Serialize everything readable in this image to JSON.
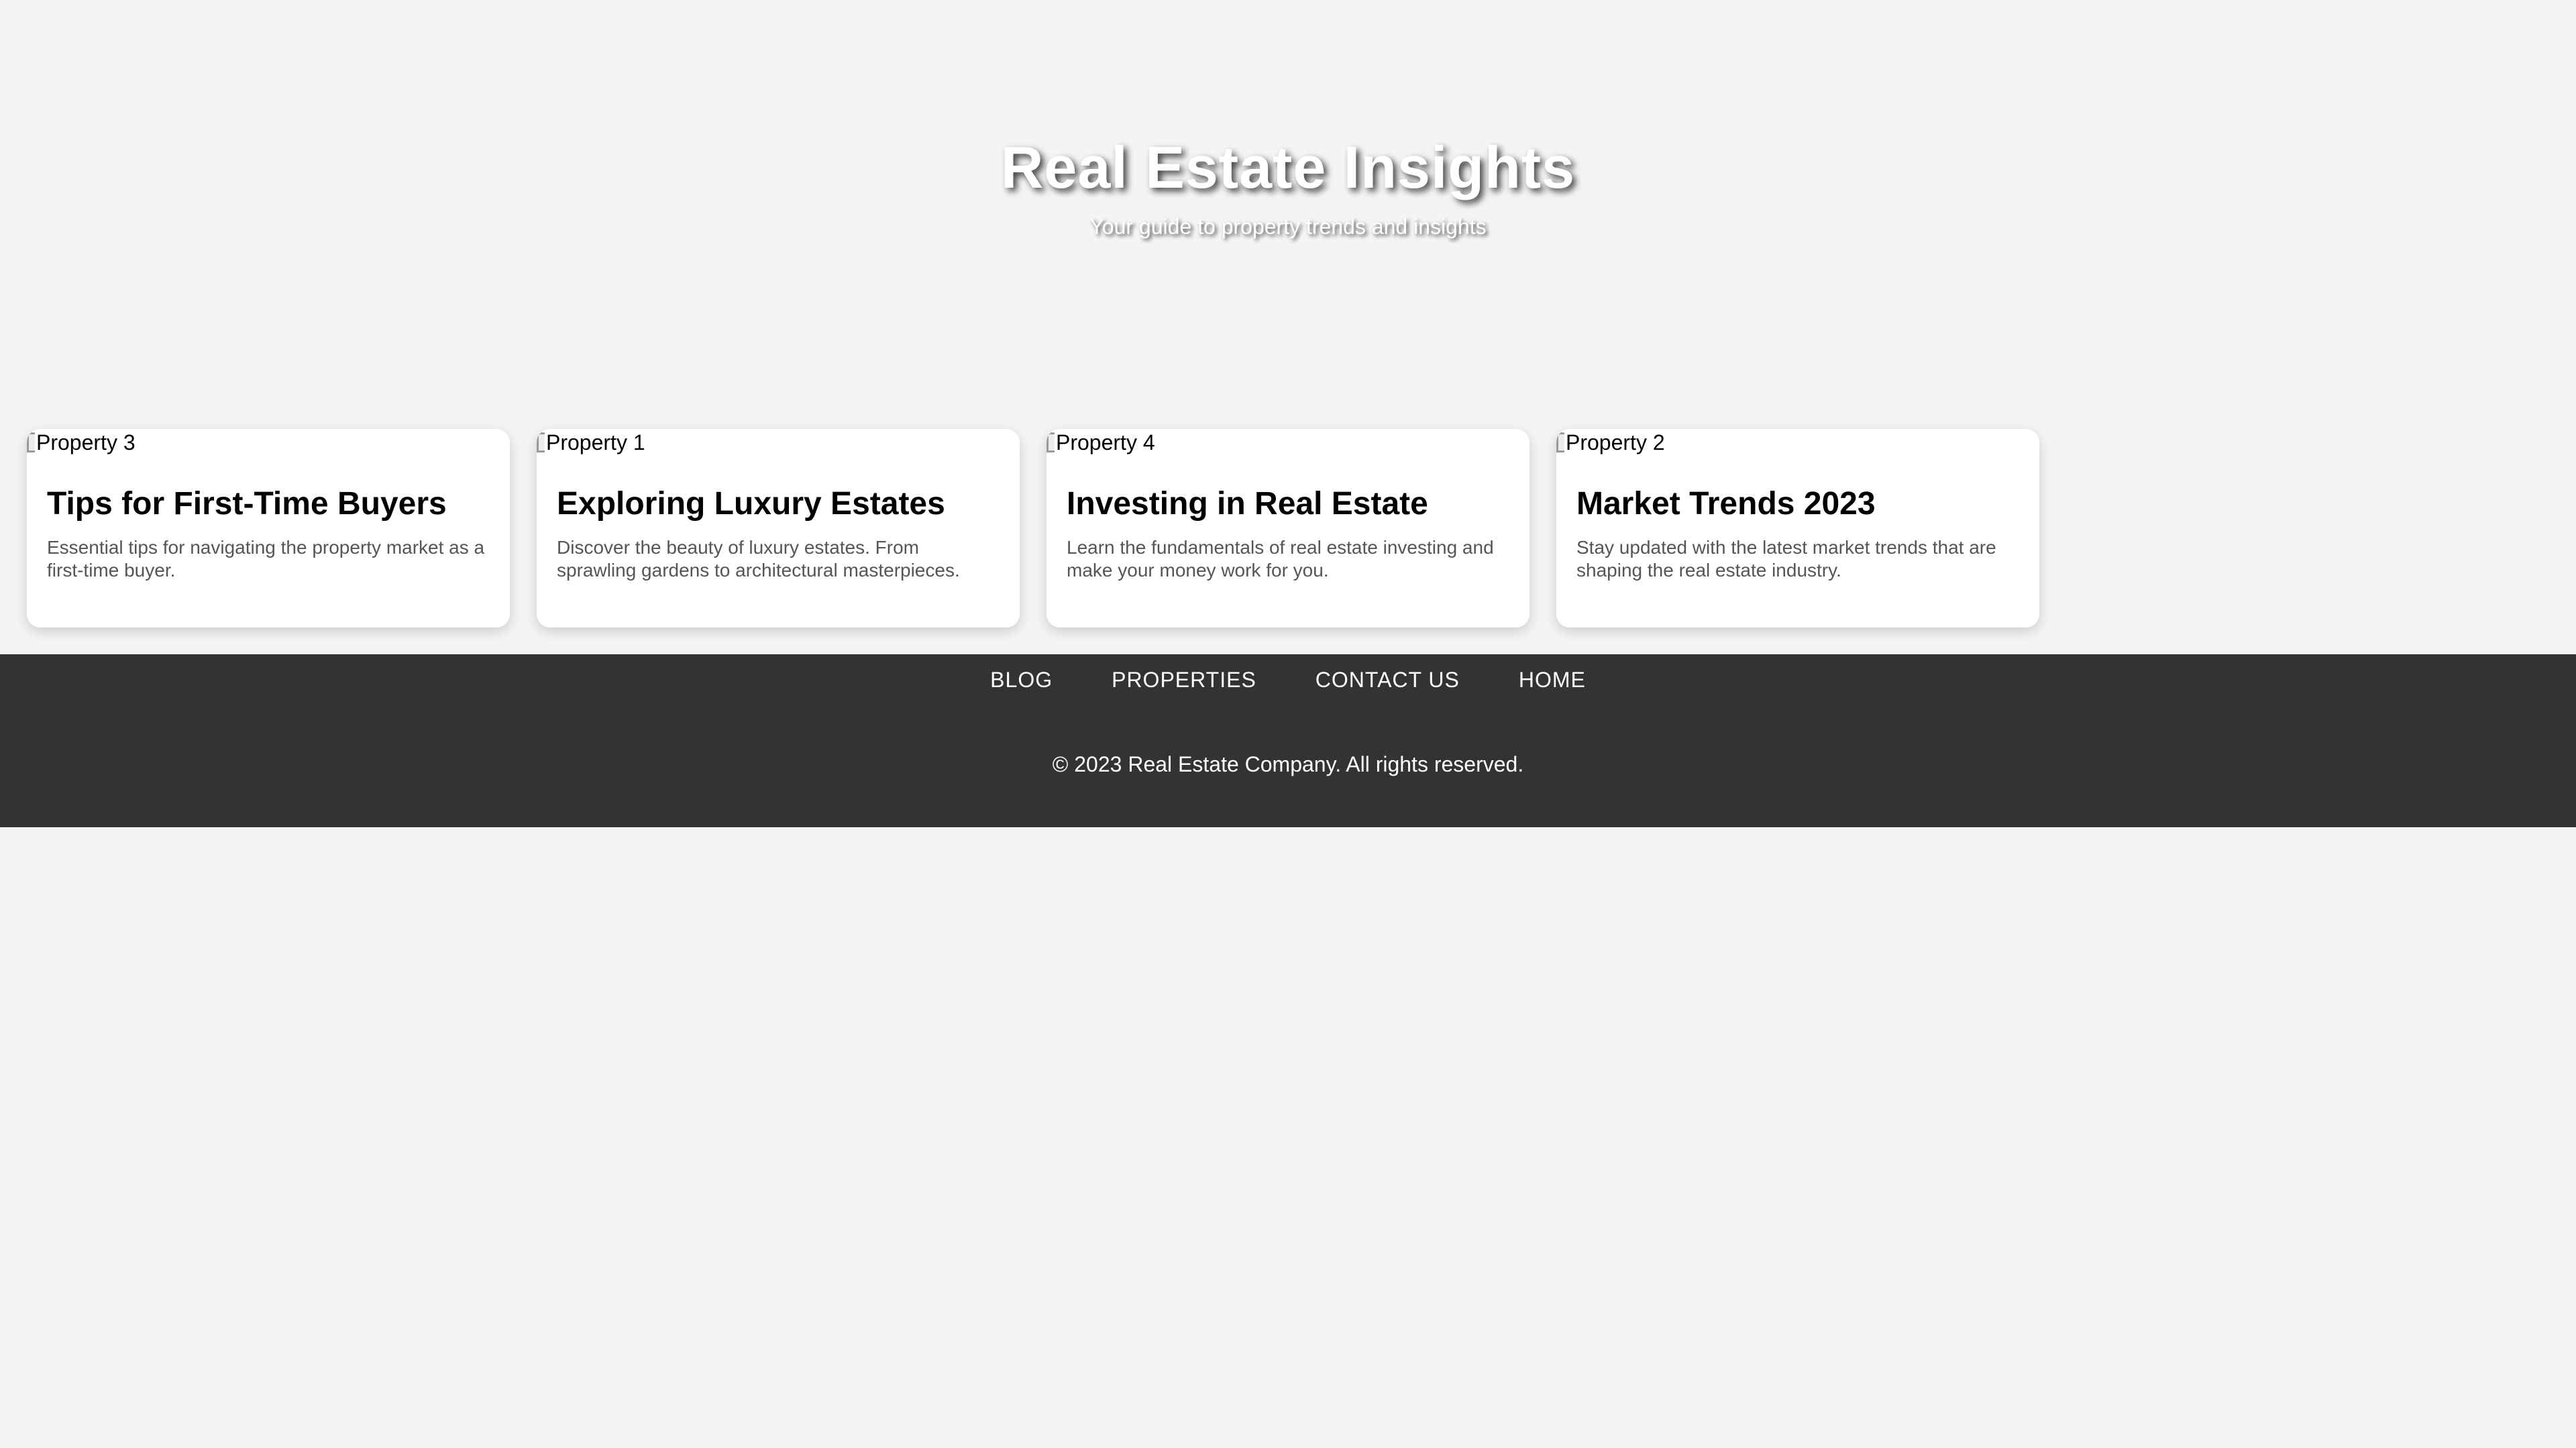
{
  "header": {
    "title": "Real Estate Insights",
    "subtitle": "Your guide to property trends and insights"
  },
  "cards": [
    {
      "image_alt": "Property 3",
      "title": "Tips for First-Time Buyers",
      "text": "Essential tips for navigating the property market as a first-time buyer."
    },
    {
      "image_alt": "Property 1",
      "title": "Exploring Luxury Estates",
      "text": "Discover the beauty of luxury estates. From sprawling gardens to architectural masterpieces."
    },
    {
      "image_alt": "Property 4",
      "title": "Investing in Real Estate",
      "text": "Learn the fundamentals of real estate investing and make your money work for you."
    },
    {
      "image_alt": "Property 2",
      "title": "Market Trends 2023",
      "text": "Stay updated with the latest market trends that are shaping the real estate industry."
    }
  ],
  "footer": {
    "nav": [
      "BLOG",
      "PROPERTIES",
      "CONTACT US",
      "HOME"
    ],
    "copyright": "© 2023 Real Estate Company. All rights reserved."
  },
  "colors": {
    "page_background": "#f4f4f4",
    "footer_background": "#333333",
    "card_background": "#ffffff",
    "card_text": "#555555",
    "hero_text": "#ffffff"
  },
  "icons": {
    "card_image": "broken-image-icon"
  }
}
